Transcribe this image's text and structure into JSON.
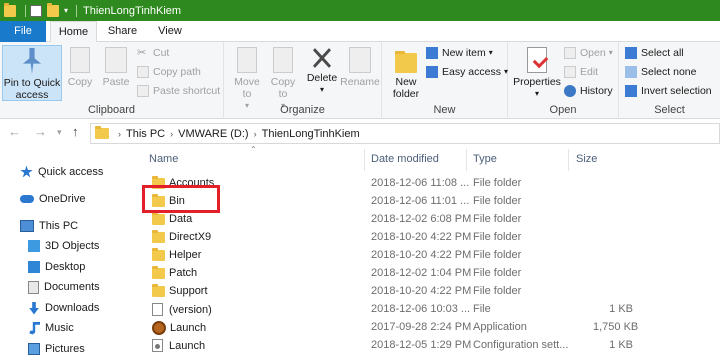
{
  "window": {
    "title": "ThienLongTinhKiem"
  },
  "tabs": {
    "file": "File",
    "home": "Home",
    "share": "Share",
    "view": "View"
  },
  "ribbon": {
    "clipboard": {
      "label": "Clipboard",
      "pin": "Pin to Quick access",
      "copy": "Copy",
      "paste": "Paste",
      "cut": "Cut",
      "copy_path": "Copy path",
      "paste_shortcut": "Paste shortcut"
    },
    "organize": {
      "label": "Organize",
      "move_to": "Move to",
      "copy_to": "Copy to",
      "delete": "Delete",
      "rename": "Rename"
    },
    "new": {
      "label": "New",
      "new_folder": "New folder",
      "new_item": "New item",
      "easy_access": "Easy access"
    },
    "open": {
      "label": "Open",
      "properties": "Properties",
      "open": "Open",
      "edit": "Edit",
      "history": "History"
    },
    "select": {
      "label": "Select",
      "select_all": "Select all",
      "select_none": "Select none",
      "invert": "Invert selection"
    }
  },
  "address": {
    "crumbs": [
      "This PC",
      "VMWARE (D:)",
      "ThienLongTinhKiem"
    ]
  },
  "nav": {
    "quick_access": "Quick access",
    "onedrive": "OneDrive",
    "this_pc": "This PC",
    "objects3d": "3D Objects",
    "desktop": "Desktop",
    "documents": "Documents",
    "downloads": "Downloads",
    "music": "Music",
    "pictures": "Pictures"
  },
  "columns": {
    "name": "Name",
    "date": "Date modified",
    "type": "Type",
    "size": "Size"
  },
  "files": [
    {
      "name": "Accounts",
      "date": "2018-12-06 11:08 ...",
      "type": "File folder",
      "size": ""
    },
    {
      "name": "Bin",
      "date": "2018-12-06 11:01 ...",
      "type": "File folder",
      "size": ""
    },
    {
      "name": "Data",
      "date": "2018-12-02 6:08 PM",
      "type": "File folder",
      "size": ""
    },
    {
      "name": "DirectX9",
      "date": "2018-10-20 4:22 PM",
      "type": "File folder",
      "size": ""
    },
    {
      "name": "Helper",
      "date": "2018-10-20 4:22 PM",
      "type": "File folder",
      "size": ""
    },
    {
      "name": "Patch",
      "date": "2018-12-02 1:04 PM",
      "type": "File folder",
      "size": ""
    },
    {
      "name": "Support",
      "date": "2018-10-20 4:22 PM",
      "type": "File folder",
      "size": ""
    },
    {
      "name": "(version)",
      "date": "2018-12-06 10:03 ...",
      "type": "File",
      "size": "1 KB"
    },
    {
      "name": "Launch",
      "date": "2017-09-28 2:24 PM",
      "type": "Application",
      "size": "1,750 KB"
    },
    {
      "name": "Launch",
      "date": "2018-12-05 1:29 PM",
      "type": "Configuration sett...",
      "size": "1 KB"
    }
  ]
}
